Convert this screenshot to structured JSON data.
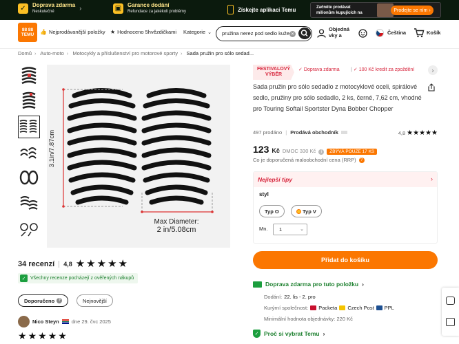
{
  "topbar": {
    "free_shipping_title": "Doprava zdarma",
    "free_shipping_sub": "Neskutečné",
    "guarantee_title": "Garance dodání",
    "guarantee_sub": "Refundace za jakékoli problémy",
    "app_label": "Získejte aplikaci Temu",
    "promo_text_1": "Začněte prodávat",
    "promo_text_2": "milionům kupujících na",
    "promo_button": "Prodejte se ním"
  },
  "header": {
    "logo_text": "TEMU",
    "nav": [
      "Nejprodávanější položky",
      "Hodnoceno 5hvězdičkami",
      "Kategorie"
    ],
    "search_value": "pružina nerez pod sedlo kuže",
    "account_label": "Objedná vky a",
    "language": "Čeština",
    "cart": "Košík"
  },
  "breadcrumb": [
    "Domů",
    "Auto-moto",
    "Motocykly a příslušenství pro motorové sporty",
    "Sada pružin pro sólo sedad..."
  ],
  "gallery": {
    "height_label": "3.1in/7.87cm",
    "diameter_label_1": "Max Diameter:",
    "diameter_label_2": "2 in/5.08cm"
  },
  "reviews": {
    "count": "34 recenzí",
    "score": "4,8",
    "verified_text": "Všechny recenze pocházejí z ověřených nákupů",
    "sort_options": [
      "Doporučeno",
      "Nejnovější"
    ],
    "first_reviewer": "Nico Steyn",
    "first_date": "dne 29. čvc 2025"
  },
  "product": {
    "badge_festival": "FESTIVALOVÝ VÝBĚR",
    "badge_shipping": "Doprava zdarma",
    "badge_credit": "100 Kč kredit za zpoždění",
    "title": "Sada pružin pro sólo sedadlo z motocyklové oceli, spirálové sedlo, pružiny pro sólo sedadlo, 2 ks, černé, 7,62 cm, vhodné pro Touring Softail Sportster Dyna Bobber Chopper",
    "sold": "497 prodáno",
    "seller": "Prodává obchodník",
    "rating_score": "4,8",
    "price": "123",
    "currency": "Kč",
    "rrp": "DMOC 330 Kč",
    "discount_tag": "ZBÝVÁ POUZE 17 KS",
    "rrp_note": "Co je doporučená maloobchodní cena (RRP)",
    "tips_title": "Nejlepší tipy",
    "style_label": "styl",
    "style_options": [
      "Typ O",
      "Typ V"
    ],
    "qty_label": "Mn.",
    "qty_value": "1",
    "add_to_cart": "Přidat do košíku",
    "shipping_title": "Doprava zdarma pro tuto položku",
    "delivery_label": "Dodání:",
    "delivery_value": "22. lis - 2. pro",
    "couriers_label": "Kurýrní společnost:",
    "couriers": [
      "Packeta",
      "Czech Post",
      "PPL"
    ],
    "min_order": "Minimální hodnota objednávky: 220 Kč",
    "why_temu": "Proč si vybrat Temu"
  },
  "colors": {
    "brand_orange": "#fb7701",
    "topbar_bg": "#0b1a0d",
    "verified_green": "#1b9e3e",
    "festival_red": "#d7263d"
  }
}
